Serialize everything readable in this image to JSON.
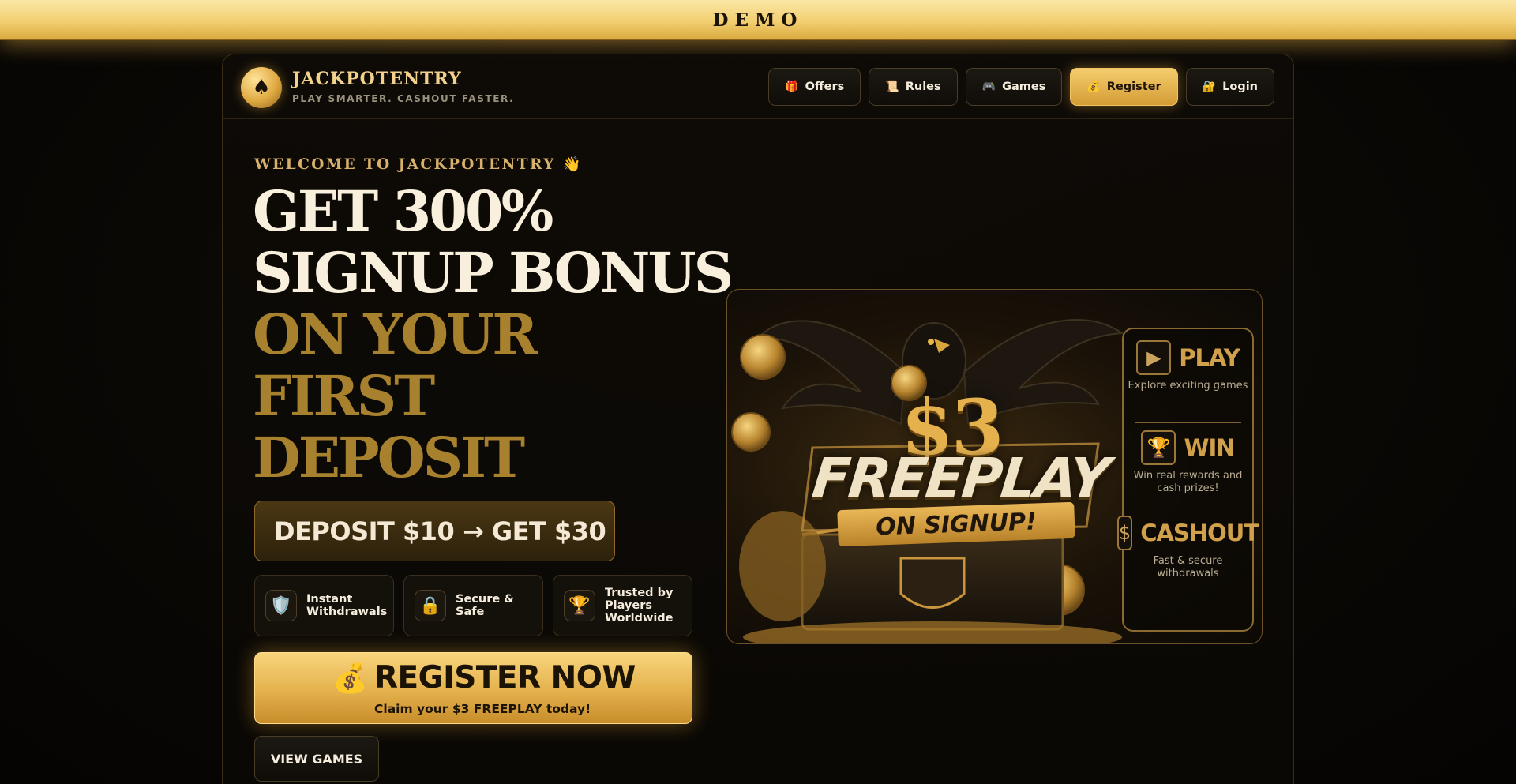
{
  "demo_banner": "DEMO",
  "brand": {
    "name": "JACKPOTENTRY",
    "tagline": "PLAY SMARTER. CASHOUT FASTER.",
    "logo_icon": "spade-icon"
  },
  "nav": {
    "items": [
      {
        "label": "Offers",
        "icon": "gift-icon",
        "glyph": "🎁"
      },
      {
        "label": "Rules",
        "icon": "scroll-icon",
        "glyph": "📜"
      },
      {
        "label": "Games",
        "icon": "gamepad-icon",
        "glyph": "🎮"
      },
      {
        "label": "Register",
        "icon": "moneybag-icon",
        "glyph": "💰"
      },
      {
        "label": "Login",
        "icon": "lock-icon",
        "glyph": "🔐"
      }
    ]
  },
  "hero": {
    "welcome": "WELCOME TO JACKPOTENTRY 👋",
    "headline_line1": "GET 300%",
    "headline_line2": "SIGNUP BONUS",
    "headline_gold_line1": "ON YOUR",
    "headline_gold_line2": "FIRST",
    "headline_gold_line3": "DEPOSIT",
    "deposit_offer": "DEPOSIT $10 → GET $30"
  },
  "features": [
    {
      "label": "Instant Withdrawals",
      "icon": "shield-icon",
      "glyph": "🛡️"
    },
    {
      "label": "Secure & Safe",
      "icon": "padlock-icon",
      "glyph": "🔒"
    },
    {
      "label": "Trusted by Players Worldwide",
      "icon": "trophy-icon",
      "glyph": "🏆"
    }
  ],
  "register_cta": {
    "title": "REGISTER NOW",
    "subtitle": "Claim your $3 FREEPLAY today!",
    "icon": "moneybag-icon"
  },
  "view_games_label": "VIEW GAMES",
  "promo_image": {
    "amount": "$3",
    "headline": "FREEPLAY",
    "ribbon": "ON SIGNUP!",
    "panel": [
      {
        "title": "PLAY",
        "desc": "Explore exciting games",
        "icon": "play-icon"
      },
      {
        "title": "WIN",
        "desc": "Win real rewards and cash prizes!",
        "icon": "trophy-icon"
      },
      {
        "title": "CASHOUT",
        "desc": "Fast & secure withdrawals",
        "icon": "dollar-icon"
      }
    ]
  },
  "colors": {
    "gold": "#e4b14c",
    "gold_light": "#f8d47c",
    "background": "#0a0805",
    "text": "#f5ead5"
  }
}
